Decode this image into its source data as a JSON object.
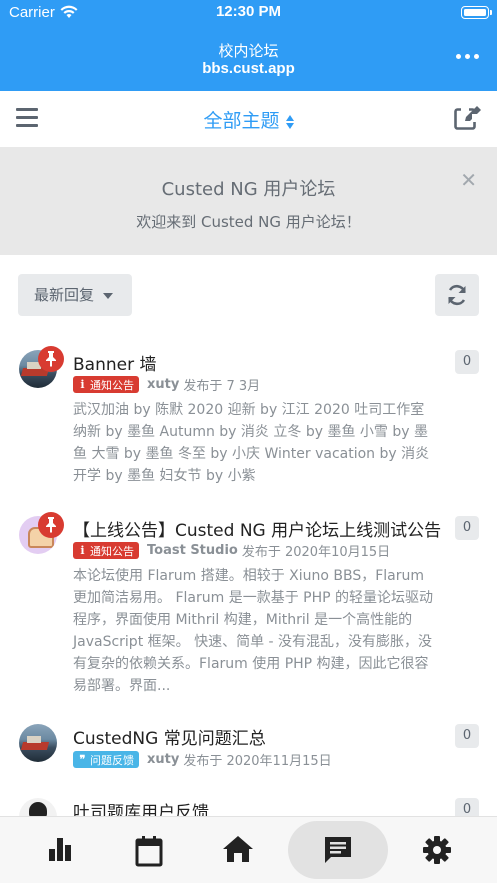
{
  "status_bar": {
    "carrier": "Carrier",
    "time": "12:30 PM"
  },
  "header": {
    "title": "校内论坛",
    "url": "bbs.cust.app"
  },
  "toolbar": {
    "topic_filter": "全部主题"
  },
  "hero": {
    "title": "Custed NG 用户论坛",
    "description": "欢迎来到 Custed NG 用户论坛！"
  },
  "sort": {
    "label": "最新回复"
  },
  "discussions": [
    {
      "title": "Banner 墙",
      "pinned": true,
      "tag": "通知公告",
      "tag_color": "#d83b31",
      "user": "xuty",
      "time": "发布于 7 3月",
      "excerpt": "武汉加油 by 陈默 2020 迎新 by 江江 2020 吐司工作室纳新 by 墨鱼 Autumn by 消炎 立冬 by 墨鱼 小雪 by 墨鱼 大雪 by 墨鱼 冬至 by 小庆 Winter vacation by 消炎 开学 by 墨鱼 妇女节 by 小紫",
      "count": "0"
    },
    {
      "title": "【上线公告】Custed NG 用户论坛上线测试公告",
      "pinned": true,
      "tag": "通知公告",
      "tag_color": "#d83b31",
      "user": "Toast Studio",
      "time": "发布于 2020年10月15日",
      "excerpt": "本论坛使用 Flarum 搭建。相较于 Xiuno BBS，Flarum 更加简洁易用。 Flarum 是一款基于 PHP 的轻量论坛驱动程序，界面使用 Mithril 构建，Mithril 是一个高性能的 JavaScript 框架。 快速、简单 - 没有混乱，没有膨胀，没有复杂的依赖关系。Flarum 使用 PHP 构建，因此它很容易部署。界面...",
      "count": "0"
    },
    {
      "title": "CustedNG 常见问题汇总",
      "pinned": false,
      "tag": "问题反馈",
      "tag_color": "#49b5e7",
      "user": "xuty",
      "time": "发布于 2020年11月15日",
      "excerpt": "",
      "count": "0"
    },
    {
      "title": "吐司题库用户反馈",
      "pinned": false,
      "count": "0"
    }
  ],
  "tabs": [
    {
      "icon": "bar-chart-icon"
    },
    {
      "icon": "calendar-icon"
    },
    {
      "icon": "home-icon"
    },
    {
      "icon": "forum-icon",
      "active": true
    },
    {
      "icon": "settings-icon"
    }
  ],
  "colors": {
    "primary": "#2f9cf5",
    "pin": "#d83b31",
    "tag_notice": "#d83b31",
    "tag_feedback": "#49b5e7"
  }
}
